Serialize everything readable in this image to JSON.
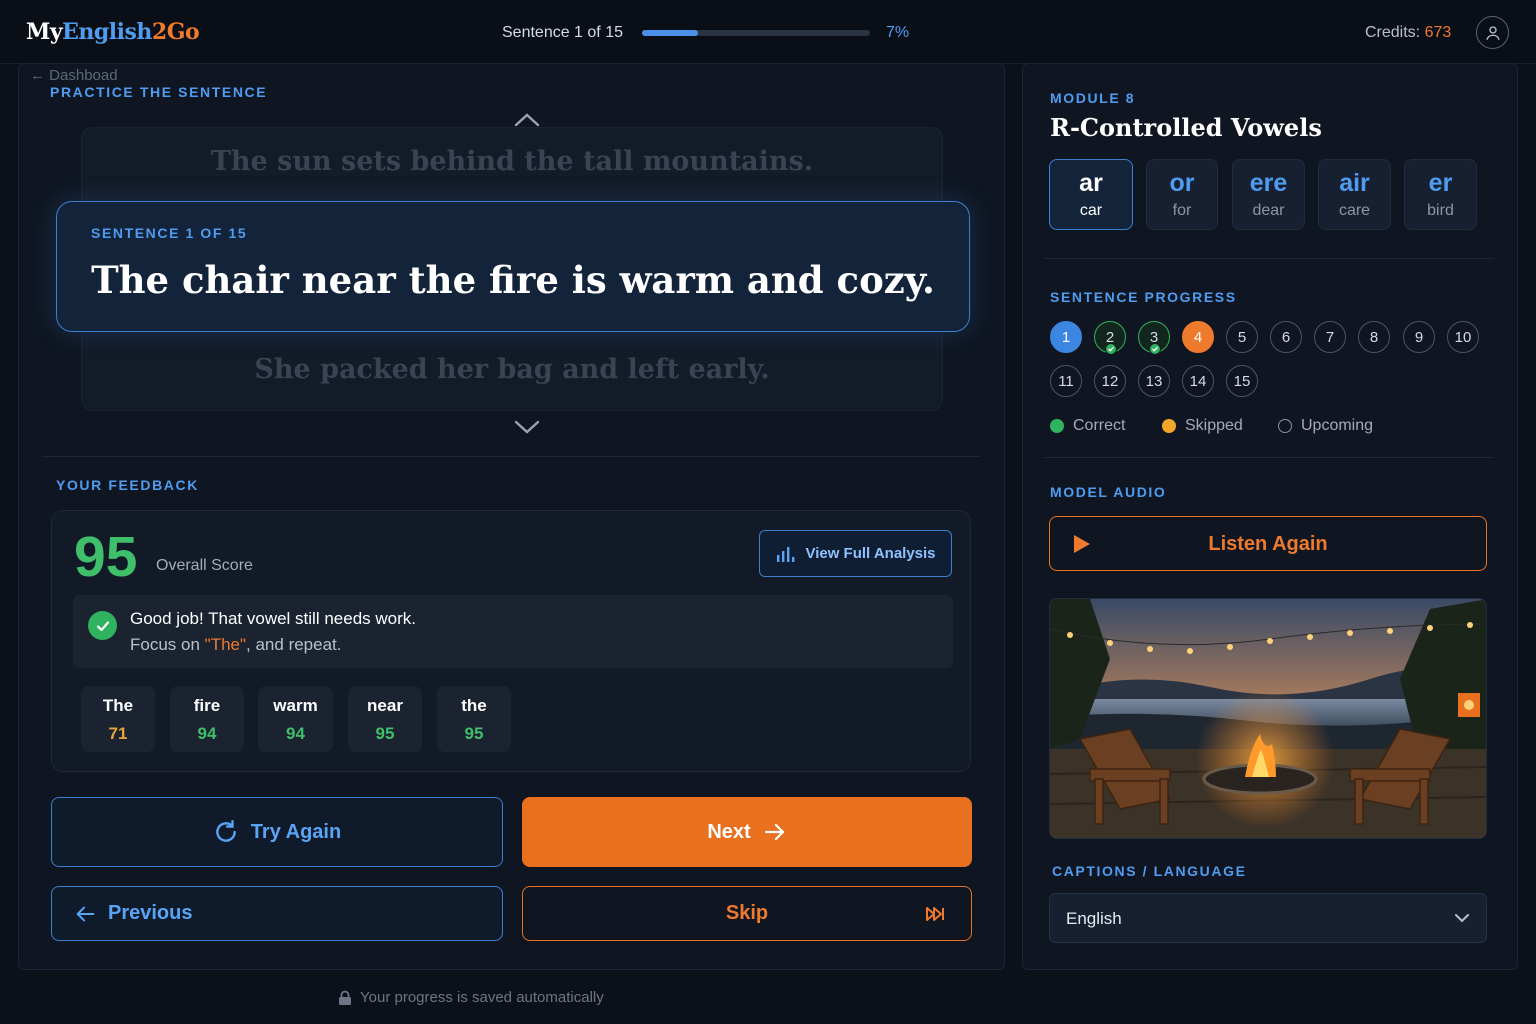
{
  "app": {
    "logo_part1": "My",
    "logo_part2": "English",
    "logo_part3": "2Go"
  },
  "header": {
    "progress_label": "Sentence 1 of 15",
    "progress_percent": "7%",
    "progress_value": 0.07,
    "credits_label": "Credits:",
    "credits_value": "673"
  },
  "nav": {
    "back_label": "Dashboad"
  },
  "practice": {
    "section_label": "PRACTICE THE SENTENCE",
    "prev_sentence": "The sun sets behind the tall mountains.",
    "current_label": "SENTENCE 1 OF 15",
    "current_sentence": "The chair near the fire is warm and cozy.",
    "next_sentence": "She packed her bag and left early."
  },
  "feedback": {
    "section_label": "YOUR FEEDBACK",
    "score": "95",
    "score_label": "Overall Score",
    "analysis_button": "View Full Analysis",
    "message_line1": "Good job! That vowel still needs work.",
    "message_prefix": "Focus on ",
    "message_highlight": "\"The\"",
    "message_suffix": ", and repeat.",
    "words": [
      {
        "word": "The",
        "score": "71",
        "color": "#e8a43a"
      },
      {
        "word": "fire",
        "score": "94",
        "color": "#3fbf6a"
      },
      {
        "word": "warm",
        "score": "94",
        "color": "#3fbf6a"
      },
      {
        "word": "near",
        "score": "95",
        "color": "#3fbf6a"
      },
      {
        "word": "the",
        "score": "95",
        "color": "#3fbf6a"
      }
    ]
  },
  "actions": {
    "try_again": "Try Again",
    "next": "Next",
    "previous": "Previous",
    "skip": "Skip"
  },
  "footer": {
    "save_note": "Your progress is saved automatically"
  },
  "module": {
    "label": "MODULE 8",
    "title": "R-Controlled Vowels",
    "sounds": [
      {
        "pattern": "ar",
        "example": "car"
      },
      {
        "pattern": "or",
        "example": "for"
      },
      {
        "pattern": "ere",
        "example": "dear"
      },
      {
        "pattern": "air",
        "example": "care"
      },
      {
        "pattern": "er",
        "example": "bird"
      }
    ]
  },
  "sentence_progress": {
    "label": "SENTENCE PROGRESS",
    "items": [
      "1",
      "2",
      "3",
      "4",
      "5",
      "6",
      "7",
      "8",
      "9",
      "10",
      "11",
      "12",
      "13",
      "14",
      "15"
    ],
    "legend_correct": "Correct",
    "legend_skipped": "Skipped",
    "legend_upcoming": "Upcoming"
  },
  "audio": {
    "label": "MODEL AUDIO",
    "listen_again": "Listen Again"
  },
  "captions": {
    "label": "CAPTIONS / LANGUAGE",
    "selected": "English"
  },
  "colors": {
    "accent_blue": "#4f9cf0",
    "accent_orange": "#e8701f",
    "success_green": "#3fbf6a"
  }
}
